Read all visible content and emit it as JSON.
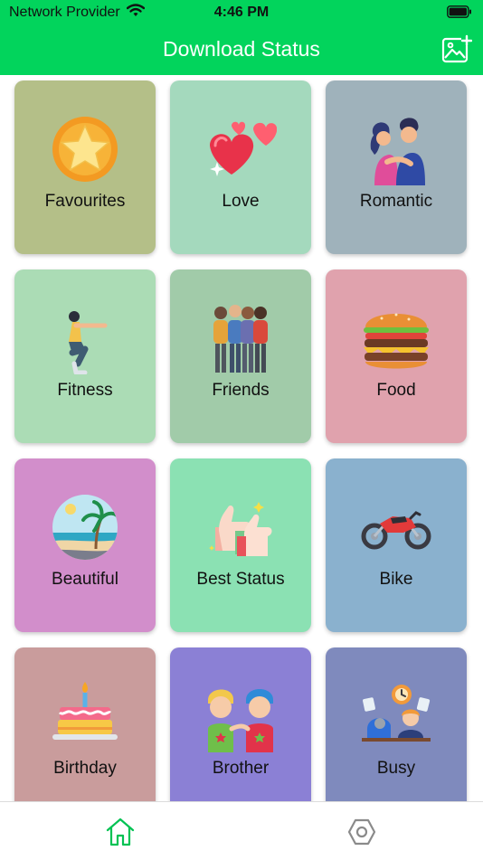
{
  "status_bar": {
    "carrier": "Network Provider",
    "time": "4:46 PM"
  },
  "app_bar": {
    "title": "Download Status",
    "action_icon": "add-image-icon"
  },
  "colors": {
    "brand": "#02d45c",
    "tab_active": "#02c253",
    "tab_inactive": "#8a8a8a"
  },
  "categories": [
    {
      "label": "Favourites",
      "icon": "star-icon",
      "bg": "#b4bf88"
    },
    {
      "label": "Love",
      "icon": "hearts-icon",
      "bg": "#a4d9bd"
    },
    {
      "label": "Romantic",
      "icon": "couple-icon",
      "bg": "#9fb2bb"
    },
    {
      "label": "Fitness",
      "icon": "squat-person-icon",
      "bg": "#abdcb5"
    },
    {
      "label": "Friends",
      "icon": "friends-group-icon",
      "bg": "#a1cba9"
    },
    {
      "label": "Food",
      "icon": "burger-icon",
      "bg": "#e0a2ad"
    },
    {
      "label": "Beautiful",
      "icon": "beach-palm-icon",
      "bg": "#d28ecb"
    },
    {
      "label": "Best Status",
      "icon": "thumbs-up-icon",
      "bg": "#8be1b3"
    },
    {
      "label": "Bike",
      "icon": "motorbike-icon",
      "bg": "#8ab1ce"
    },
    {
      "label": "Birthday",
      "icon": "cake-icon",
      "bg": "#c99c9c"
    },
    {
      "label": "Brother",
      "icon": "brothers-icon",
      "bg": "#8b80d5"
    },
    {
      "label": "Busy",
      "icon": "busy-worker-icon",
      "bg": "#7f8abd"
    }
  ],
  "tabs": [
    {
      "name": "home",
      "icon": "home-icon",
      "active": true
    },
    {
      "name": "settings",
      "icon": "settings-hexagon-icon",
      "active": false
    }
  ]
}
